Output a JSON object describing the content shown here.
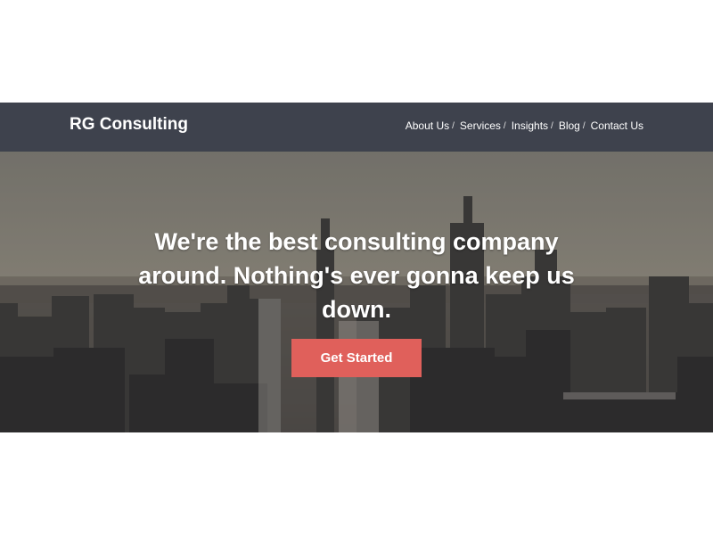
{
  "header": {
    "brand": "RG Consulting",
    "nav": [
      {
        "label": "About Us",
        "separator": "/"
      },
      {
        "label": "Services",
        "separator": "/"
      },
      {
        "label": "Insights",
        "separator": "/"
      },
      {
        "label": "Blog",
        "separator": "/"
      },
      {
        "label": "Contact Us",
        "separator": ""
      }
    ]
  },
  "hero": {
    "headline": "We're the best consulting company around. Nothing's ever gonna keep us down.",
    "cta_label": "Get Started",
    "background": "city-skyline-image"
  },
  "colors": {
    "header_bg": "#3e424d",
    "cta_bg": "#e0605b",
    "text": "#ffffff"
  }
}
